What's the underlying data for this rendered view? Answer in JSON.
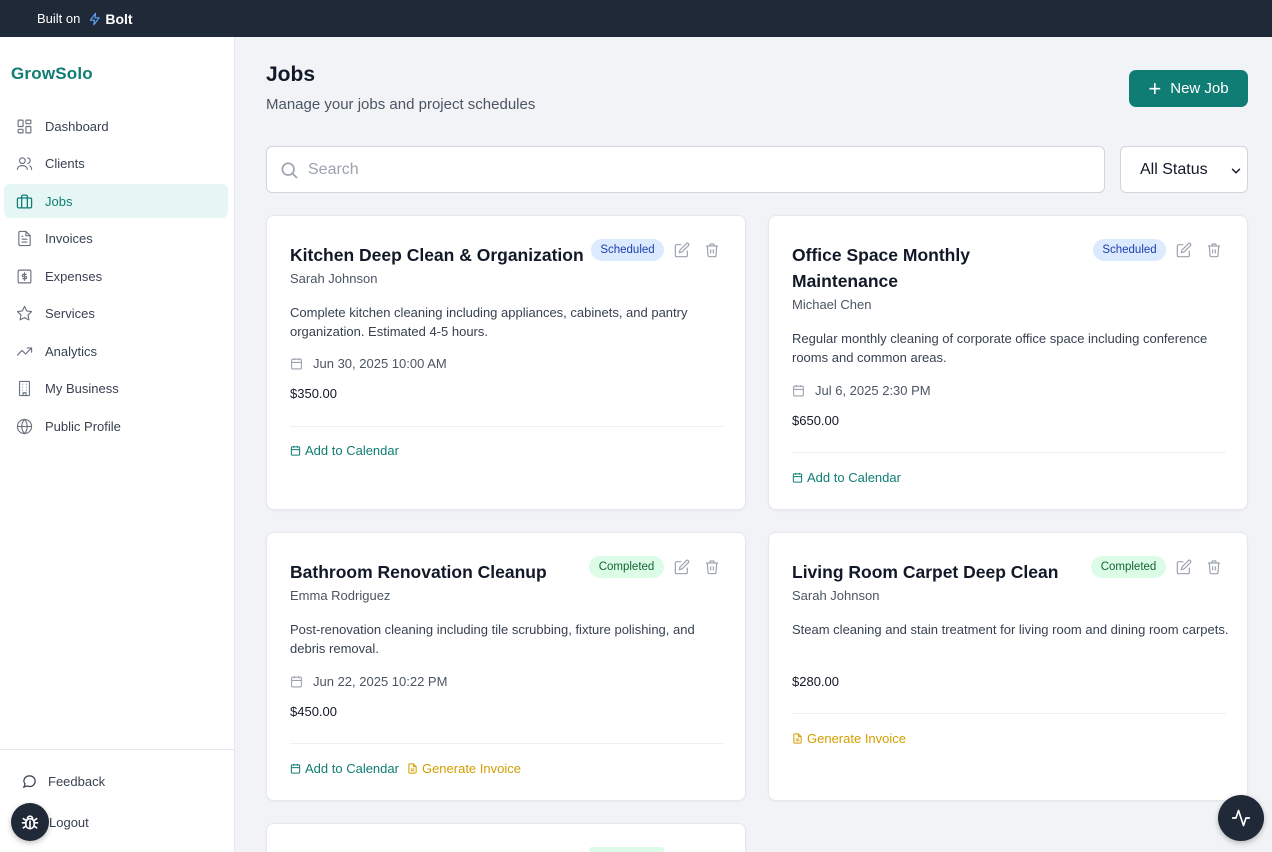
{
  "topbar": {
    "prefix": "Built on",
    "brand": "Bolt"
  },
  "sidebar": {
    "brand": "GrowSolo",
    "items": [
      {
        "label": "Dashboard",
        "icon": "dashboard-icon"
      },
      {
        "label": "Clients",
        "icon": "users-icon"
      },
      {
        "label": "Jobs",
        "icon": "briefcase-icon",
        "active": true
      },
      {
        "label": "Invoices",
        "icon": "file-text-icon"
      },
      {
        "label": "Expenses",
        "icon": "dollar-icon"
      },
      {
        "label": "Services",
        "icon": "star-icon"
      },
      {
        "label": "Analytics",
        "icon": "trending-up-icon"
      },
      {
        "label": "My Business",
        "icon": "building-icon"
      },
      {
        "label": "Public Profile",
        "icon": "globe-icon"
      }
    ],
    "feedback": "Feedback",
    "logout": "Logout"
  },
  "header": {
    "title": "Jobs",
    "subtitle": "Manage your jobs and project schedules",
    "new_job_label": "New Job"
  },
  "filters": {
    "search_placeholder": "Search",
    "status_value": "All Status"
  },
  "links": {
    "add_calendar": "Add to Calendar",
    "generate_invoice": "Generate Invoice"
  },
  "jobs": [
    {
      "title": "Kitchen Deep Clean & Organization",
      "status": "Scheduled",
      "client": "Sarah Johnson",
      "description": "Complete kitchen cleaning including appliances, cabinets, and pantry organization. Estimated 4-5 hours.",
      "date": "Jun 30, 2025 10:00 AM",
      "price": "$350.00"
    },
    {
      "title": "Office Space Monthly Maintenance",
      "status": "Scheduled",
      "client": "Michael Chen",
      "description": "Regular monthly cleaning of corporate office space including conference rooms and common areas.",
      "date": "Jul 6, 2025 2:30 PM",
      "price": "$650.00"
    },
    {
      "title": "Bathroom Renovation Cleanup",
      "status": "Completed",
      "client": "Emma Rodriguez",
      "description": "Post-renovation cleaning including tile scrubbing, fixture polishing, and debris removal.",
      "date": "Jun 22, 2025 10:22 PM",
      "price": "$450.00"
    },
    {
      "title": "Living Room Carpet Deep Clean",
      "status": "Completed",
      "client": "Sarah Johnson",
      "description": "Steam cleaning and stain treatment for living room and dining room carpets.",
      "price": "$280.00"
    }
  ],
  "colors": {
    "accent": "#0f7d74",
    "topbar": "#1f2937",
    "scheduled_bg": "#dbeafe",
    "completed_bg": "#dcfce7",
    "invoice_link": "#d39e00"
  }
}
